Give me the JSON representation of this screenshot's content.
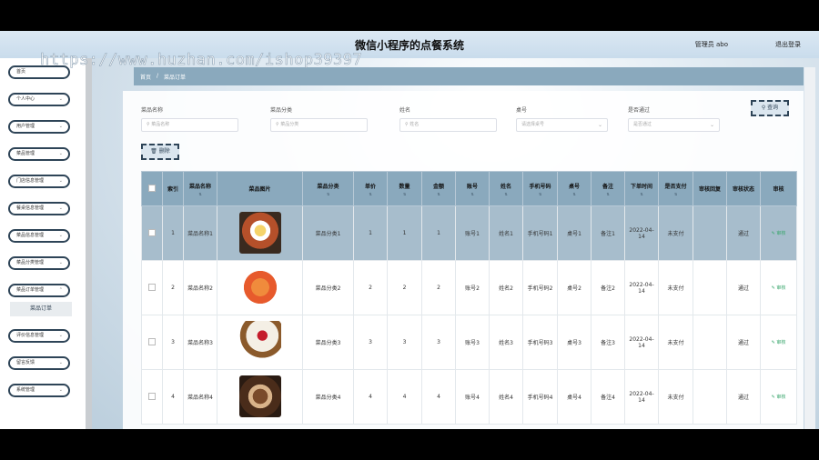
{
  "header": {
    "title": "微信小程序的点餐系统",
    "admin_label": "管理员 abo",
    "logout_label": "退出登录",
    "watermark": "https://www.huzhan.com/ishop39397"
  },
  "sidebar": {
    "items": [
      {
        "label": "首页"
      },
      {
        "label": "个人中心"
      },
      {
        "label": "用户管理"
      },
      {
        "label": "菜品管理"
      },
      {
        "label": "门店信息管理"
      },
      {
        "label": "餐桌信息管理"
      },
      {
        "label": "菜品信息管理"
      },
      {
        "label": "菜品分类管理"
      },
      {
        "label": "菜品订单管理"
      },
      {
        "label": "评价信息管理"
      },
      {
        "label": "留言反馈"
      },
      {
        "label": "系统管理"
      }
    ],
    "submenu": {
      "label": "菜品订单"
    }
  },
  "breadcrumb": {
    "home": "首页",
    "sep": "/",
    "current": "菜品订单"
  },
  "filters": {
    "dish_name": {
      "label": "菜品名称",
      "placeholder": "菜品名称"
    },
    "dish_category": {
      "label": "菜品分类",
      "placeholder": "菜品分类"
    },
    "name": {
      "label": "姓名",
      "placeholder": "姓名"
    },
    "table_no": {
      "label": "桌号",
      "placeholder": "请选择桌号"
    },
    "approved": {
      "label": "是否通过",
      "placeholder": "是否通过"
    },
    "query_button": "查询",
    "delete_button": "删除"
  },
  "table": {
    "columns": [
      "索引",
      "菜品名称",
      "菜品图片",
      "菜品分类",
      "单价",
      "数量",
      "金额",
      "账号",
      "姓名",
      "手机号码",
      "桌号",
      "备注",
      "下单时间",
      "是否支付",
      "审核回复",
      "审核状态",
      "审核"
    ],
    "rows": [
      {
        "index": "1",
        "name": "菜品名称1",
        "category": "菜品分类1",
        "price": "1",
        "qty": "1",
        "amount": "1",
        "account": "账号1",
        "person": "姓名1",
        "phone": "手机号码1",
        "table": "桌号1",
        "note": "备注1",
        "time": "2022-04-14",
        "paid": "未支付",
        "reply": "",
        "status": "通过",
        "action": "审核",
        "selected": true
      },
      {
        "index": "2",
        "name": "菜品名称2",
        "category": "菜品分类2",
        "price": "2",
        "qty": "2",
        "amount": "2",
        "account": "账号2",
        "person": "姓名2",
        "phone": "手机号码2",
        "table": "桌号2",
        "note": "备注2",
        "time": "2022-04-14",
        "paid": "未支付",
        "reply": "",
        "status": "通过",
        "action": "审核",
        "selected": false
      },
      {
        "index": "3",
        "name": "菜品名称3",
        "category": "菜品分类3",
        "price": "3",
        "qty": "3",
        "amount": "3",
        "account": "账号3",
        "person": "姓名3",
        "phone": "手机号码3",
        "table": "桌号3",
        "note": "备注3",
        "time": "2022-04-14",
        "paid": "未支付",
        "reply": "",
        "status": "通过",
        "action": "审核",
        "selected": false
      },
      {
        "index": "4",
        "name": "菜品名称4",
        "category": "菜品分类4",
        "price": "4",
        "qty": "4",
        "amount": "4",
        "account": "账号4",
        "person": "姓名4",
        "phone": "手机号码4",
        "table": "桌号4",
        "note": "备注4",
        "time": "2022-04-14",
        "paid": "未支付",
        "reply": "",
        "status": "通过",
        "action": "审核",
        "selected": false
      }
    ]
  },
  "colors": {
    "accent": "#2e4457",
    "header_bg": "#8aa9bd",
    "selected_row": "#a7bdcc",
    "audit_link": "#3aa76d"
  }
}
